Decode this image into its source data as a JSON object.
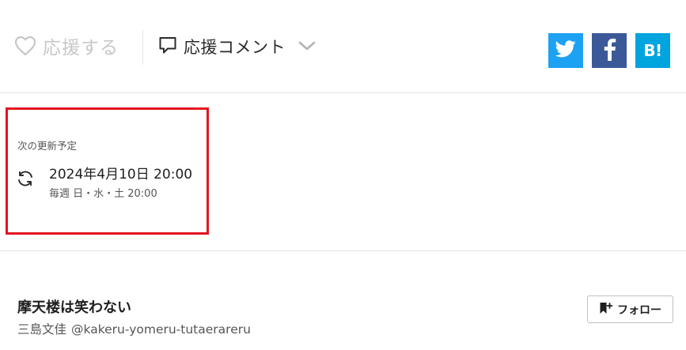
{
  "actions": {
    "cheer_label": "応援する",
    "comment_label": "応援コメント"
  },
  "share": {
    "twitter_icon": "twitter-icon",
    "facebook_icon": "facebook-icon",
    "hatena_label": "B!"
  },
  "next_update": {
    "heading": "次の更新予定",
    "datetime": "2024年4月10日 20:00",
    "schedule": "毎週 日・水・土 20:00"
  },
  "work": {
    "title": "摩天楼は笑わない",
    "author_name": "三島文佳",
    "author_id": "@kakeru-yomeru-tutaerareru",
    "follow_label": "フォロー"
  },
  "colors": {
    "twitter": "#1da1f2",
    "facebook": "#3b5998",
    "hatena": "#00a4de",
    "highlight_border": "#e3141e"
  }
}
